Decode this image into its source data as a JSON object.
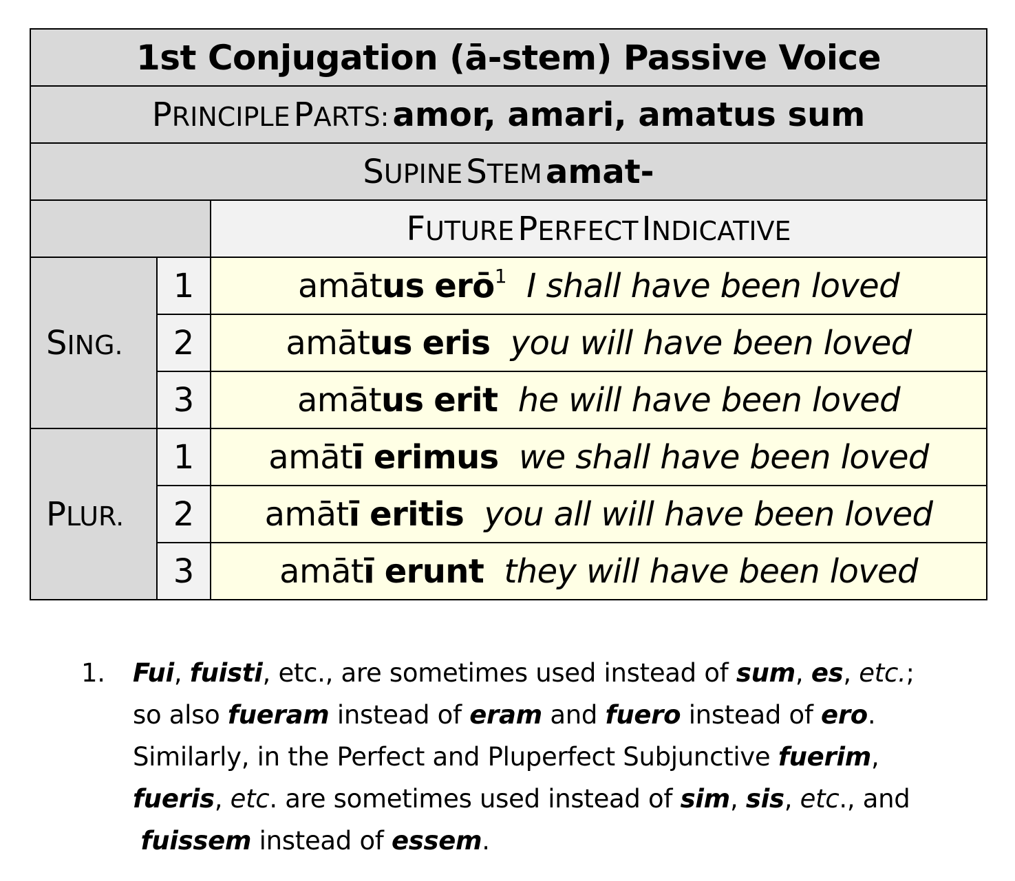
{
  "title": "1st Conjugation (ā-stem) Passive Voice",
  "principal_parts": {
    "label_first": "P",
    "label_rest": "RINCIPLE",
    "label_first2": "P",
    "label_rest2": "ARTS:",
    "value": "amor, amari, amatus sum"
  },
  "supine": {
    "label_first": "S",
    "label_rest": "UPINE",
    "label_first2": "S",
    "label_rest2": "TEM",
    "value": "amat-"
  },
  "mood": {
    "w1_first": "F",
    "w1_rest": "UTURE",
    "w2_first": "P",
    "w2_rest": "ERFECT",
    "w3_first": "I",
    "w3_rest": "NDICATIVE"
  },
  "groups": {
    "singular": {
      "first": "S",
      "rest": "ING."
    },
    "plural": {
      "first": "P",
      "rest": "LUR."
    }
  },
  "rows": [
    {
      "person": "1",
      "stem": "amāt",
      "ending": "us",
      "aux": "erō",
      "note": "1",
      "gloss": "I shall have been loved"
    },
    {
      "person": "2",
      "stem": "amāt",
      "ending": "us",
      "aux": "eris",
      "note": "",
      "gloss": "you will have been loved"
    },
    {
      "person": "3",
      "stem": "amāt",
      "ending": "us",
      "aux": "erit",
      "note": "",
      "gloss": "he will have been loved"
    },
    {
      "person": "1",
      "stem": "amāt",
      "ending": "ī",
      "aux": "erimus",
      "note": "",
      "gloss": "we shall have been loved"
    },
    {
      "person": "2",
      "stem": "amāt",
      "ending": "ī",
      "aux": "eritis",
      "note": "",
      "gloss": "you all will have been loved"
    },
    {
      "person": "3",
      "stem": "amāt",
      "ending": "ī",
      "aux": "erunt",
      "note": "",
      "gloss": "they will have been loved"
    }
  ],
  "footnote": {
    "number": "1.",
    "l1": {
      "a": "Fui",
      "b": ", ",
      "c": "fuisti",
      "d": ", etc., are sometimes used instead of ",
      "e": "sum",
      "f": ", ",
      "g": "es",
      "h": ", ",
      "i": "etc.",
      "j": ";"
    },
    "l2": {
      "a": "so also ",
      "b": "fueram",
      "c": " instead of ",
      "d": "eram",
      "e": " and ",
      "f": "fuero",
      "g": " instead of ",
      "h": "ero",
      "i": "."
    },
    "l3": {
      "a": "Similarly, in the Perfect and Pluperfect Subjunctive ",
      "b": "fuerim",
      "c": ","
    },
    "l4": {
      "a": "fueris",
      "b": ", ",
      "c": "etc",
      "d": ". are sometimes used instead of ",
      "e": "sim",
      "f": ", ",
      "g": "sis",
      "h": ", ",
      "i": "etc",
      "j": "., and"
    },
    "l5": {
      "a": "fuissem",
      "b": " instead of ",
      "c": "essem",
      "d": "."
    }
  }
}
